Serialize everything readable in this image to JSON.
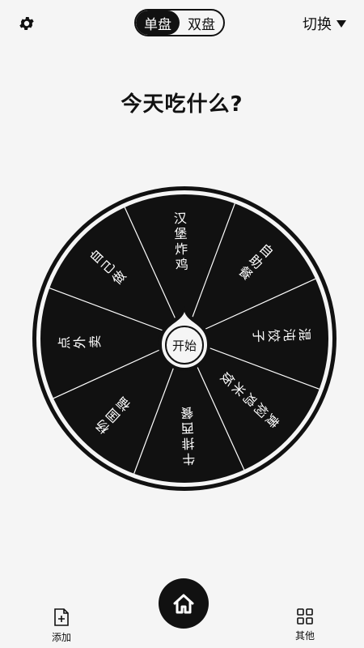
{
  "header": {
    "settings_icon": "gear-icon",
    "mode_single": "单盘",
    "mode_double": "双盘",
    "switch_label": "切换",
    "switch_icon": "caret-down-icon"
  },
  "title": "今天吃什么?",
  "wheel": {
    "segments": [
      "汉堡炸鸡",
      "自助餐",
      "混沌饺子",
      "黄焖鸡米饭",
      "牛排西餐",
      "杨国福",
      "点外卖",
      "自己做"
    ],
    "start_label": "开始",
    "colors": {
      "segment": "#111111",
      "divider": "#ffffff",
      "ring": "#111111"
    }
  },
  "bottom_nav": {
    "add_label": "添加",
    "add_icon": "add-file-icon",
    "home_icon": "home-icon",
    "more_label": "其他",
    "more_icon": "grid-icon"
  }
}
